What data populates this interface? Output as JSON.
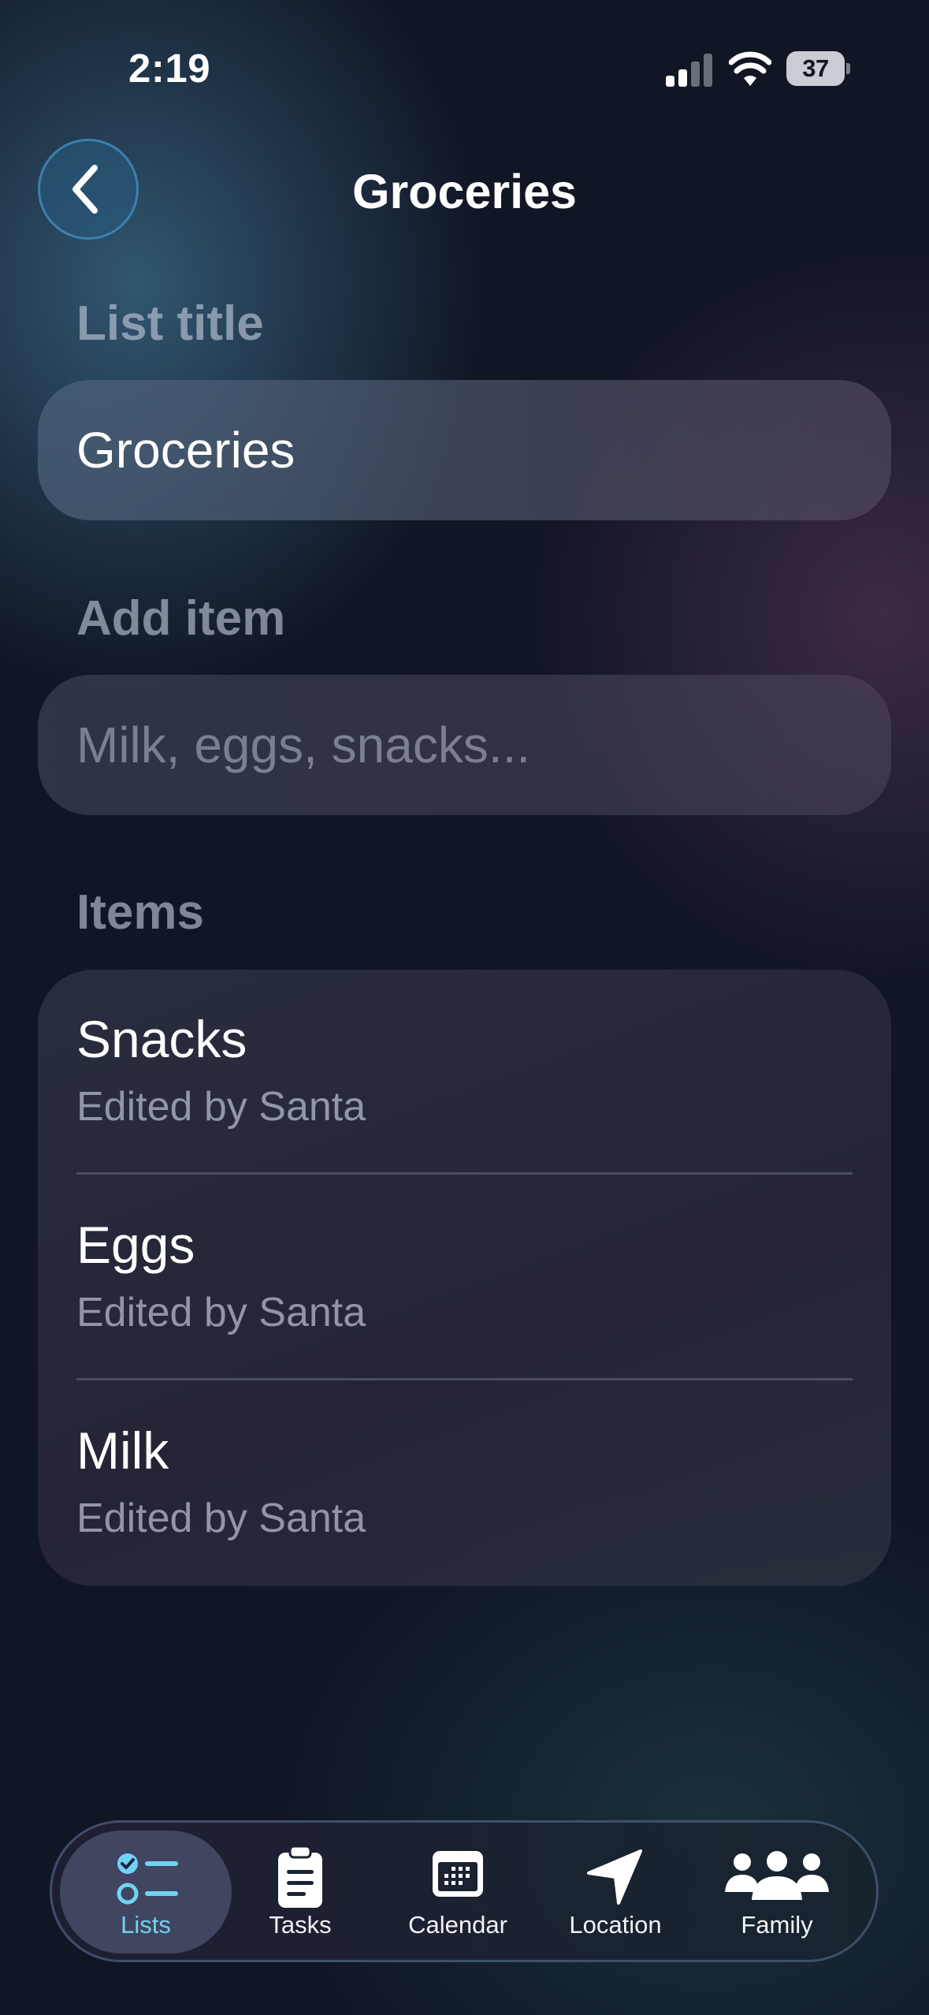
{
  "status_bar": {
    "time": "2:19",
    "battery": "37",
    "icons": [
      "cellular-signal-icon",
      "wifi-icon",
      "battery-icon"
    ]
  },
  "header": {
    "title": "Groceries",
    "back_icon": "chevron-left-icon"
  },
  "list_title": {
    "label": "List title",
    "value": "Groceries"
  },
  "add_item": {
    "label": "Add item",
    "placeholder": "Milk, eggs, snacks..."
  },
  "items": {
    "label": "Items",
    "list": [
      {
        "name": "Snacks",
        "subtitle": "Edited by Santa"
      },
      {
        "name": "Eggs",
        "subtitle": "Edited by Santa"
      },
      {
        "name": "Milk",
        "subtitle": "Edited by Santa"
      }
    ]
  },
  "tab_bar": {
    "tabs": [
      {
        "label": "Lists",
        "icon": "checklist-icon",
        "active": true
      },
      {
        "label": "Tasks",
        "icon": "clipboard-icon",
        "active": false
      },
      {
        "label": "Calendar",
        "icon": "calendar-icon",
        "active": false
      },
      {
        "label": "Location",
        "icon": "location-arrow-icon",
        "active": false
      },
      {
        "label": "Family",
        "icon": "people-icon",
        "active": false
      }
    ]
  },
  "colors": {
    "accent": "#6fd3f3",
    "background": "#111625",
    "back_button": "#26587a"
  }
}
